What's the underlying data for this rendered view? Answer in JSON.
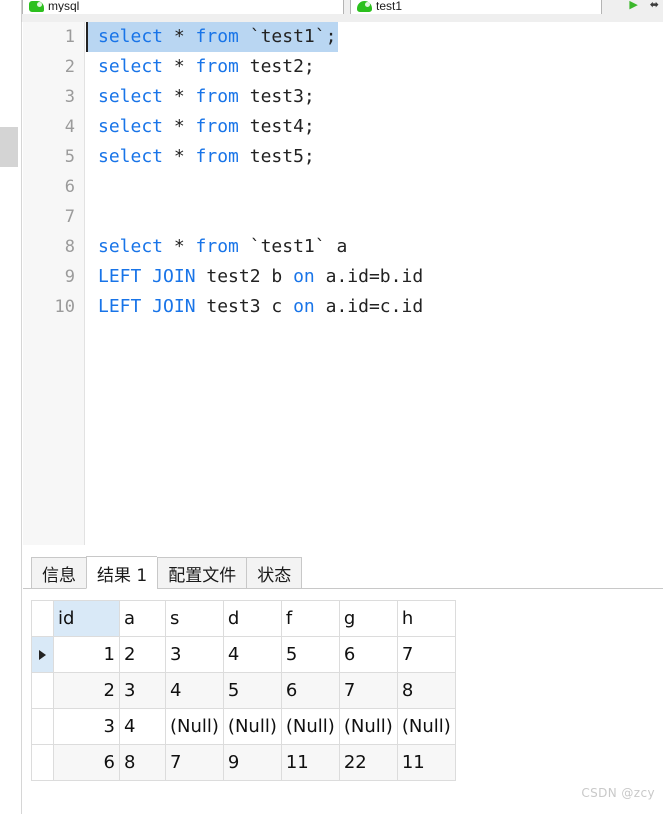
{
  "topbar": {
    "tabs": [
      {
        "label": "mysql",
        "icon": "mysql-dolphin-icon"
      },
      {
        "label": "test1",
        "icon": "mysql-dolphin-icon"
      }
    ],
    "actions": [
      {
        "name": "run-button",
        "glyph": "▶"
      },
      {
        "name": "more-button",
        "glyph": "⬌"
      }
    ]
  },
  "editor": {
    "line_numbers": [
      "1",
      "2",
      "3",
      "4",
      "5",
      "6",
      "7",
      "8",
      "9",
      "10"
    ],
    "lines": [
      {
        "n": "1",
        "selected": true,
        "tokens": [
          {
            "t": "kw",
            "v": "select"
          },
          {
            "t": "op",
            "v": " * "
          },
          {
            "t": "kw",
            "v": "from"
          },
          {
            "t": "id",
            "v": " `test1`;"
          }
        ]
      },
      {
        "n": "2",
        "selected": false,
        "tokens": [
          {
            "t": "kw",
            "v": "select"
          },
          {
            "t": "op",
            "v": " * "
          },
          {
            "t": "kw",
            "v": "from"
          },
          {
            "t": "id",
            "v": " test2;"
          }
        ]
      },
      {
        "n": "3",
        "selected": false,
        "tokens": [
          {
            "t": "kw",
            "v": "select"
          },
          {
            "t": "op",
            "v": " * "
          },
          {
            "t": "kw",
            "v": "from"
          },
          {
            "t": "id",
            "v": " test3;"
          }
        ]
      },
      {
        "n": "4",
        "selected": false,
        "tokens": [
          {
            "t": "kw",
            "v": "select"
          },
          {
            "t": "op",
            "v": " * "
          },
          {
            "t": "kw",
            "v": "from"
          },
          {
            "t": "id",
            "v": " test4;"
          }
        ]
      },
      {
        "n": "5",
        "selected": false,
        "tokens": [
          {
            "t": "kw",
            "v": "select"
          },
          {
            "t": "op",
            "v": " * "
          },
          {
            "t": "kw",
            "v": "from"
          },
          {
            "t": "id",
            "v": " test5;"
          }
        ]
      },
      {
        "n": "6",
        "selected": false,
        "tokens": []
      },
      {
        "n": "7",
        "selected": false,
        "tokens": []
      },
      {
        "n": "8",
        "selected": false,
        "tokens": [
          {
            "t": "kw",
            "v": "select"
          },
          {
            "t": "op",
            "v": " * "
          },
          {
            "t": "kw",
            "v": "from"
          },
          {
            "t": "id",
            "v": " `test1` a"
          }
        ]
      },
      {
        "n": "9",
        "selected": false,
        "tokens": [
          {
            "t": "kw",
            "v": "LEFT JOIN"
          },
          {
            "t": "id",
            "v": " test2 b "
          },
          {
            "t": "kw",
            "v": "on"
          },
          {
            "t": "id",
            "v": " a.id=b.id"
          }
        ]
      },
      {
        "n": "10",
        "selected": false,
        "tokens": [
          {
            "t": "kw",
            "v": "LEFT JOIN"
          },
          {
            "t": "id",
            "v": " test3 c "
          },
          {
            "t": "kw",
            "v": "on"
          },
          {
            "t": "id",
            "v": " a.id=c.id"
          }
        ]
      }
    ],
    "full_text": "select * from `test1`;\nselect * from test2;\nselect * from test3;\nselect * from test4;\nselect * from test5;\n\n\nselect * from `test1` a\nLEFT JOIN test2 b on a.id=b.id\nLEFT JOIN test3 c on a.id=c.id",
    "keyword_color": "#1874e8",
    "selection_color": "#b9d6f2"
  },
  "results_panel": {
    "tabs": [
      {
        "label": "信息",
        "active": false
      },
      {
        "label": "结果 1",
        "active": true
      },
      {
        "label": "配置文件",
        "active": false
      },
      {
        "label": "状态",
        "active": false
      }
    ],
    "grid": {
      "columns": [
        "id",
        "a",
        "s",
        "d",
        "f",
        "g",
        "h"
      ],
      "selected_column": "id",
      "rows": [
        {
          "current": true,
          "cells": [
            "1",
            "2",
            "3",
            "4",
            "5",
            "6",
            "7"
          ]
        },
        {
          "current": false,
          "cells": [
            "2",
            "3",
            "4",
            "5",
            "6",
            "7",
            "8"
          ]
        },
        {
          "current": false,
          "cells": [
            "3",
            "4",
            "(Null)",
            "(Null)",
            "(Null)",
            "(Null)",
            "(Null)"
          ]
        },
        {
          "current": false,
          "cells": [
            "6",
            "8",
            "7",
            "9",
            "11",
            "22",
            "11"
          ]
        }
      ],
      "null_label": "(Null)",
      "null_color": "#b6bfd6",
      "header_highlight_color": "#d9e9f7"
    }
  },
  "watermark": {
    "text": "CSDN @zcy"
  }
}
